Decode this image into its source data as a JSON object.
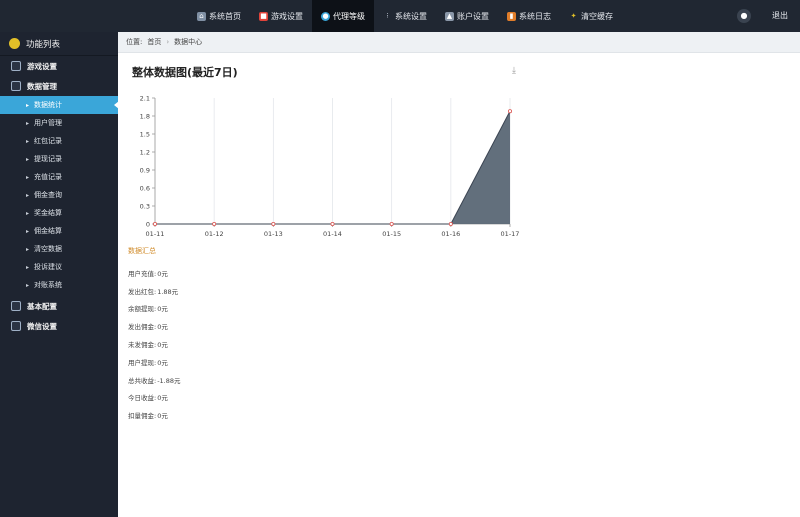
{
  "topnav": {
    "items": [
      {
        "label": "系统首页",
        "icon": "home-icon",
        "color": "#cfd8e3"
      },
      {
        "label": "游戏设置",
        "icon": "game-icon",
        "color": "#e0433a"
      },
      {
        "label": "代理等级",
        "icon": "agent-icon",
        "color": "#3aa6d9"
      },
      {
        "label": "系统设置",
        "icon": "settings-icon",
        "color": "#cfd8e3"
      },
      {
        "label": "账户设置",
        "icon": "account-icon",
        "color": "#cfd8e3"
      },
      {
        "label": "系统日志",
        "icon": "log-icon",
        "color": "#e07d2a"
      },
      {
        "label": "清空缓存",
        "icon": "clear-cache-icon",
        "color": "#e2c028"
      }
    ],
    "active_index": 2,
    "logout_label": "退出"
  },
  "sidebar": {
    "header_label": "功能列表",
    "group_game_settings": "游戏设置",
    "group_data_mgmt": "数据管理",
    "sub_items": [
      "数据统计",
      "用户管理",
      "红包记录",
      "提现记录",
      "充值记录",
      "佣金查询",
      "奖金结算",
      "佣金结算",
      "清空数据",
      "投诉建议",
      "对账系统"
    ],
    "active_sub_index": 0,
    "group_basic": "基本配置",
    "group_wechat": "微信设置"
  },
  "breadcrumb": {
    "prefix": "位置:",
    "home": "首页",
    "sep": "›",
    "current": "数据中心"
  },
  "panel": {
    "title": "整体数据图(最近7日)"
  },
  "chart_data": {
    "type": "area",
    "title": "",
    "xlabel": "",
    "ylabel": "",
    "x": [
      "01-11",
      "01-12",
      "01-13",
      "01-14",
      "01-15",
      "01-16",
      "01-17"
    ],
    "series": [
      {
        "values": [
          0,
          0,
          0,
          0,
          0,
          0,
          1.88
        ]
      }
    ],
    "yticks": [
      "0",
      "0.3",
      "0.6",
      "0.9",
      "1.2",
      "1.5",
      "1.8",
      "2.1"
    ],
    "ylim": [
      0,
      2.1
    ],
    "grid": "vertical",
    "fill_color": "#5a6775",
    "line_color": "#3b4452",
    "point_color": "#d9534f"
  },
  "summary": {
    "title": "数据汇总",
    "rows": [
      {
        "label": "用户充值:",
        "value": "0元"
      },
      {
        "label": "发出红包:",
        "value": "1.88元"
      },
      {
        "label": "余额提现:",
        "value": "0元"
      },
      {
        "label": "发出佣金:",
        "value": "0元"
      },
      {
        "label": "未发佣金:",
        "value": "0元"
      },
      {
        "label": "用户提现:",
        "value": "0元"
      },
      {
        "label": "总共收益:",
        "value": "-1.88元"
      },
      {
        "label": "今日收益:",
        "value": "0元"
      },
      {
        "label": "扣量佣金:",
        "value": "0元"
      }
    ]
  }
}
